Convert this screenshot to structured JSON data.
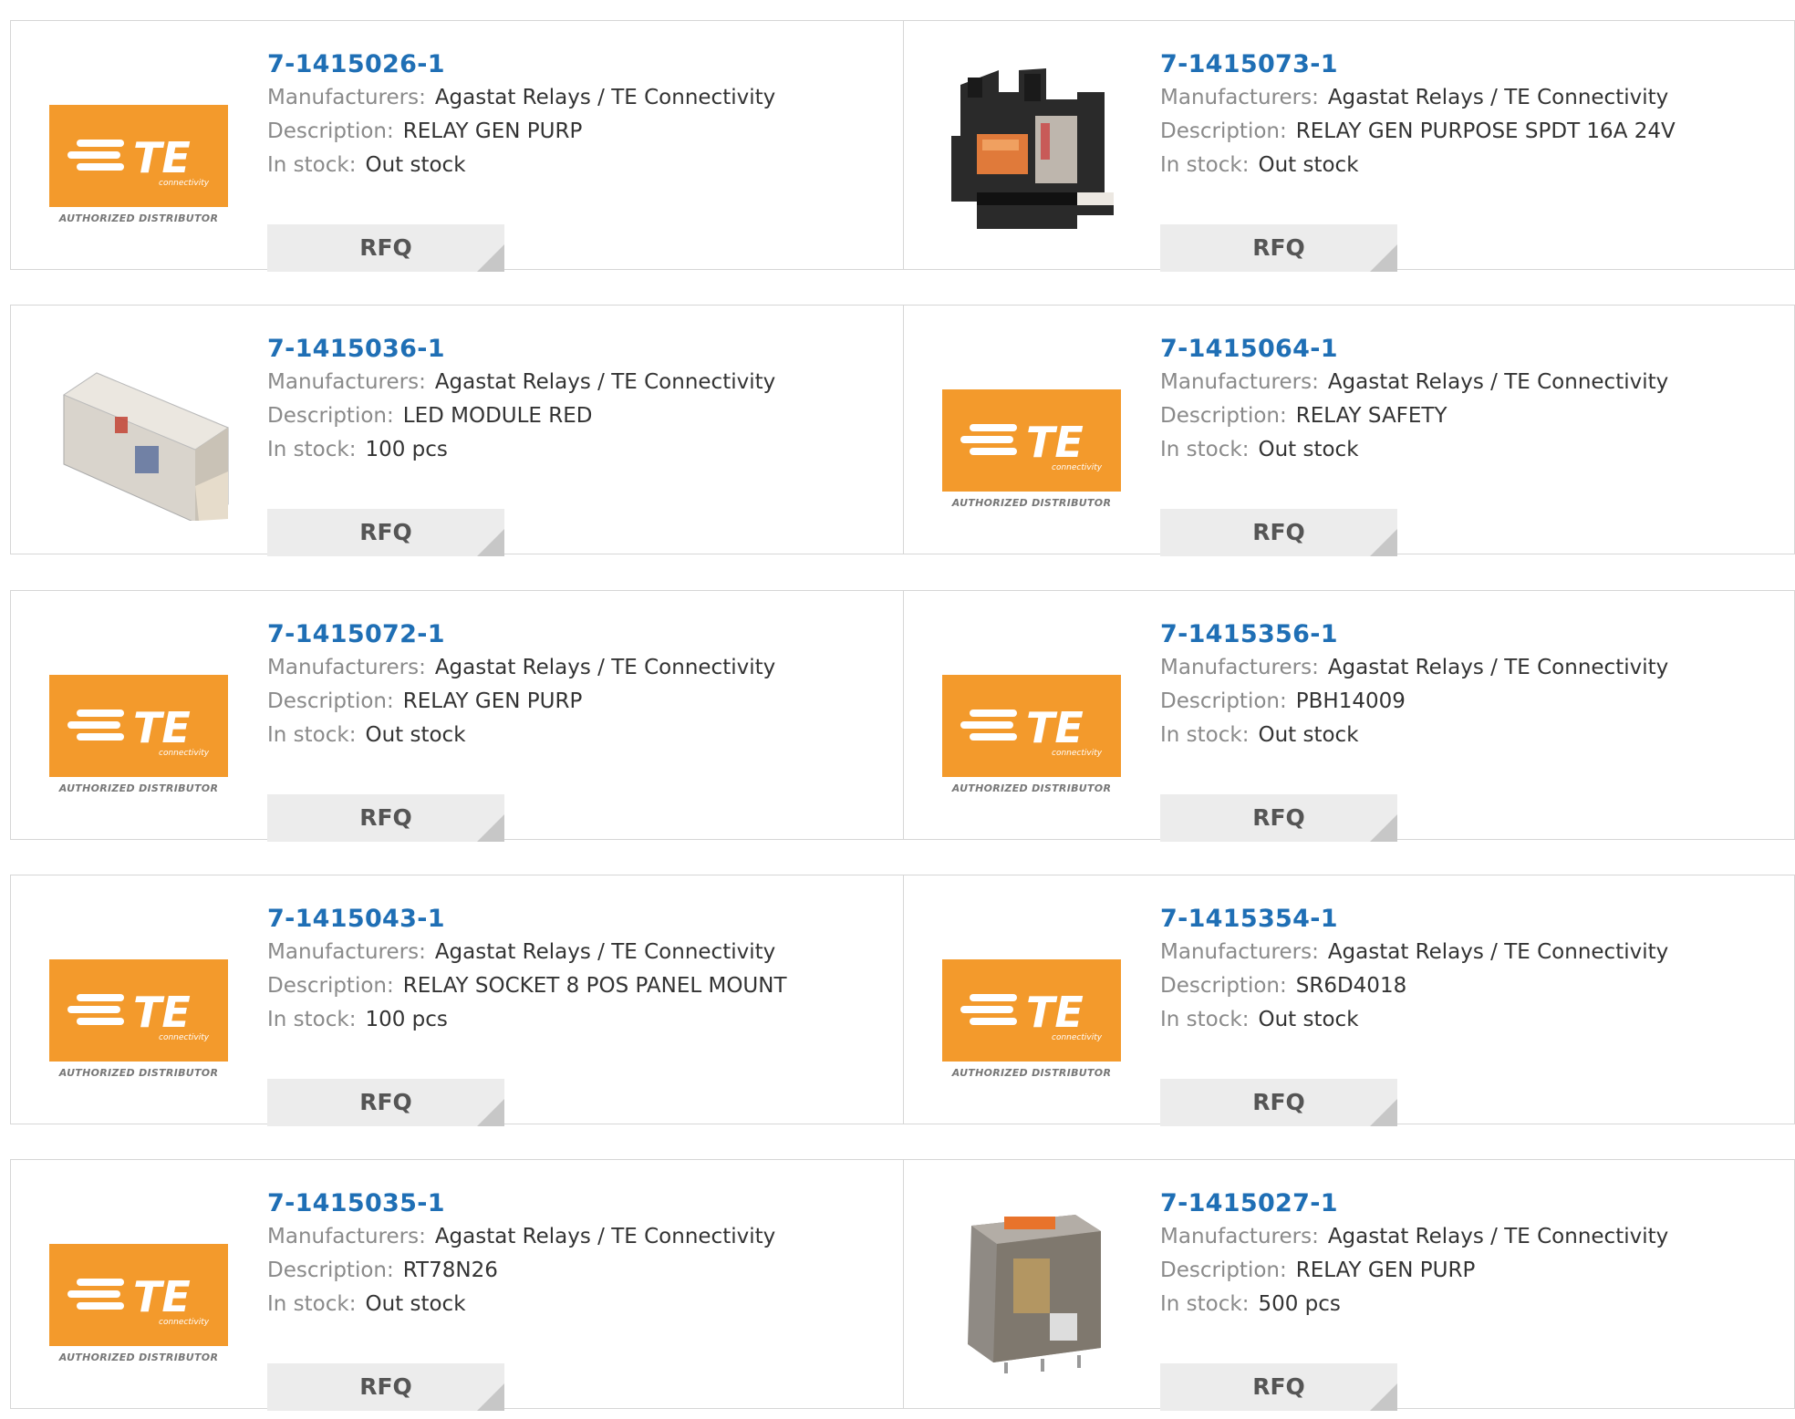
{
  "labels": {
    "manufacturers": "Manufacturers:",
    "description": "Description:",
    "in_stock": "In stock:",
    "rfq": "RFQ"
  },
  "logo": {
    "brand": "TE",
    "sub": "connectivity",
    "caption": "AUTHORIZED DISTRIBUTOR",
    "color": "#f39a2c"
  },
  "products": [
    {
      "part": "7-1415026-1",
      "manufacturer": "Agastat Relays / TE Connectivity",
      "description": "RELAY GEN PURP",
      "stock": "Out stock",
      "image": "te-logo"
    },
    {
      "part": "7-1415073-1",
      "manufacturer": "Agastat Relays / TE Connectivity",
      "description": "RELAY GEN PURPOSE SPDT 16A 24V",
      "stock": "Out stock",
      "image": "relay-socket-photo"
    },
    {
      "part": "7-1415036-1",
      "manufacturer": "Agastat Relays / TE Connectivity",
      "description": "LED MODULE RED",
      "stock": "100 pcs",
      "image": "led-module-photo"
    },
    {
      "part": "7-1415064-1",
      "manufacturer": "Agastat Relays / TE Connectivity",
      "description": "RELAY SAFETY",
      "stock": "Out stock",
      "image": "te-logo"
    },
    {
      "part": "7-1415072-1",
      "manufacturer": "Agastat Relays / TE Connectivity",
      "description": "RELAY GEN PURP",
      "stock": "Out stock",
      "image": "te-logo"
    },
    {
      "part": "7-1415356-1",
      "manufacturer": "Agastat Relays / TE Connectivity",
      "description": "PBH14009",
      "stock": "Out stock",
      "image": "te-logo"
    },
    {
      "part": "7-1415043-1",
      "manufacturer": "Agastat Relays / TE Connectivity",
      "description": "RELAY SOCKET 8 POS PANEL MOUNT",
      "stock": "100 pcs",
      "image": "te-logo"
    },
    {
      "part": "7-1415354-1",
      "manufacturer": "Agastat Relays / TE Connectivity",
      "description": "SR6D4018",
      "stock": "Out stock",
      "image": "te-logo"
    },
    {
      "part": "7-1415035-1",
      "manufacturer": "Agastat Relays / TE Connectivity",
      "description": "RT78N26",
      "stock": "Out stock",
      "image": "te-logo"
    },
    {
      "part": "7-1415027-1",
      "manufacturer": "Agastat Relays / TE Connectivity",
      "description": "RELAY GEN PURP",
      "stock": "500 pcs",
      "image": "relay-cube-photo"
    }
  ]
}
